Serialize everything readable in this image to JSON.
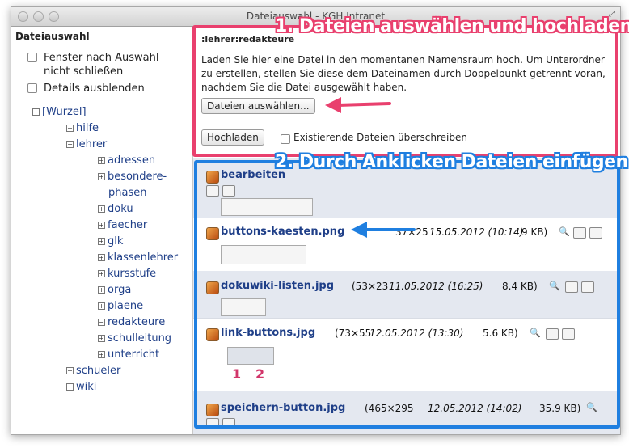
{
  "window": {
    "title": "Dateiauswahl - KGH Intranet"
  },
  "sidebar": {
    "heading": "Dateiauswahl",
    "options": [
      {
        "label_line1": "Fenster nach Auswahl",
        "label_line2": "nicht schließen"
      },
      {
        "label_line1": "Details ausblenden",
        "label_line2": ""
      }
    ],
    "tree": {
      "root": "[Wurzel]",
      "level1a": [
        "hilfe",
        "lehrer"
      ],
      "lehrer_children": [
        "adressen",
        "besondere-",
        "phasen",
        "doku",
        "faecher",
        "glk",
        "klassenlehrer",
        "kursstufe",
        "orga",
        "plaene",
        "redakteure",
        "schulleitung",
        "unterricht"
      ],
      "level1b": [
        "schueler",
        "wiki"
      ]
    }
  },
  "upload": {
    "namespace": ":lehrer:redakteure",
    "text_line1": "Laden Sie hier eine Datei in den momentanen Namensraum hoch. Um Unterordner",
    "text_line2": "zu erstellen, stellen Sie diese dem Dateinamen durch Doppelpunkt getrennt voran,",
    "text_line3": "nachdem Sie die Datei ausgewählt haben.",
    "choose_button": "Dateien auswählen...",
    "upload_button": "Hochladen",
    "overwrite_label": "Existierende Dateien überschreiben"
  },
  "files": [
    {
      "name": "bearbeiten",
      "dims": "",
      "date": "",
      "size": ""
    },
    {
      "name": "buttons-kaesten.png",
      "dims": "37×25",
      "date": "15.05.2012 (10:14)",
      "size": "9 KB)"
    },
    {
      "name": "dokuwiki-listen.jpg",
      "dims": "(53×23",
      "date": "11.05.2012 (16:25)",
      "size": "8.4 KB)"
    },
    {
      "name": "link-buttons.jpg",
      "dims": "(73×55",
      "date": "12.05.2012 (13:30)",
      "size": "5.6 KB)"
    },
    {
      "name": "speichern-button.jpg",
      "dims": "(465×295",
      "date": "12.05.2012 (14:02)",
      "size": "35.9 KB)"
    }
  ],
  "annotations": {
    "step1": "1. Dateien auswählen und hochladen",
    "step2": "2. Durch Anklicken Dateien einfügen",
    "num1": "1",
    "num2": "2"
  },
  "colors": {
    "pink": "#e9406e",
    "blue": "#1f7fe0",
    "link": "#1f3f88"
  }
}
